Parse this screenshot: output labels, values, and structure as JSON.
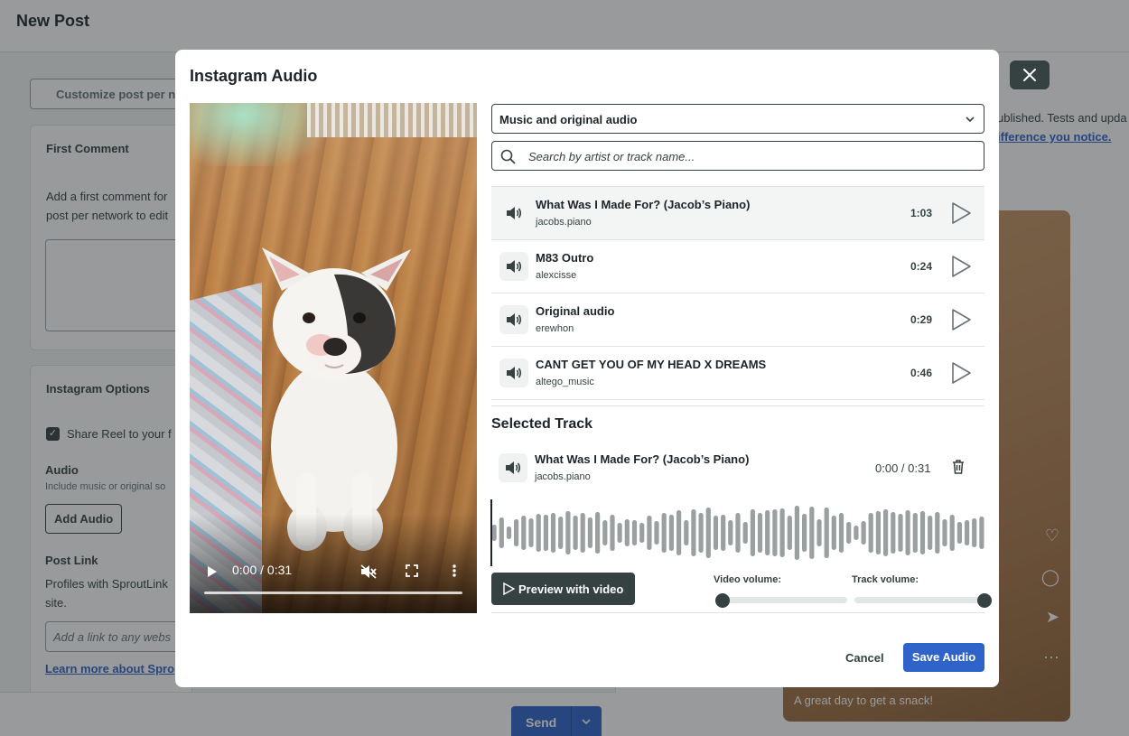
{
  "background": {
    "page_title": "New Post",
    "customize_placeholder": "Customize post per n",
    "first_comment": {
      "heading": "First Comment",
      "description_line1": "Add a first comment for",
      "description_line2": "post per network to edit"
    },
    "instagram_options": {
      "heading": "Instagram Options",
      "share_reel_label": "Share Reel to your f",
      "audio_heading": "Audio",
      "audio_description": "Include music or original so",
      "add_audio_button": "Add Audio",
      "post_link_heading": "Post Link",
      "post_link_description_line1": "Profiles with SproutLink",
      "post_link_description_line2": "site.",
      "link_placeholder": "Add a link to any webs",
      "learn_more_link": "Learn more about Spro"
    },
    "right_notice_line1": "ublished. Tests and upda",
    "right_notice_link": "ifference you notice.",
    "preview_caption": "A great day to get a snack!",
    "send_button": "Send"
  },
  "modal": {
    "title": "Instagram Audio",
    "video": {
      "time": "0:00 / 0:31"
    },
    "audio_type_select": "Music and original audio",
    "search_placeholder": "Search by artist or track name...",
    "tracks": [
      {
        "name": "What Was I Made For? (Jacob’s Piano)",
        "artist": "jacobs.piano",
        "duration": "1:03",
        "active": true
      },
      {
        "name": "M83 Outro",
        "artist": "alexcisse",
        "duration": "0:24",
        "active": false
      },
      {
        "name": "Original audio",
        "artist": "erewhon",
        "duration": "0:29",
        "active": false
      },
      {
        "name": "CANT GET YOU OF MY HEAD X DREAMS",
        "artist": "altego_music",
        "duration": "0:46",
        "active": false
      }
    ],
    "selected": {
      "heading": "Selected Track",
      "name": "What Was I Made For? (Jacob’s Piano)",
      "artist": "jacobs.piano",
      "time": "0:00 / 0:31"
    },
    "preview_button": "Preview with video",
    "video_volume_label": "Video volume:",
    "track_volume_label": "Track volume:",
    "video_volume": 0,
    "track_volume": 1,
    "cancel_button": "Cancel",
    "save_button": "Save Audio"
  },
  "colors": {
    "primary": "#2f63c9",
    "dark": "#364141",
    "waveform": "#9a9f9f"
  }
}
